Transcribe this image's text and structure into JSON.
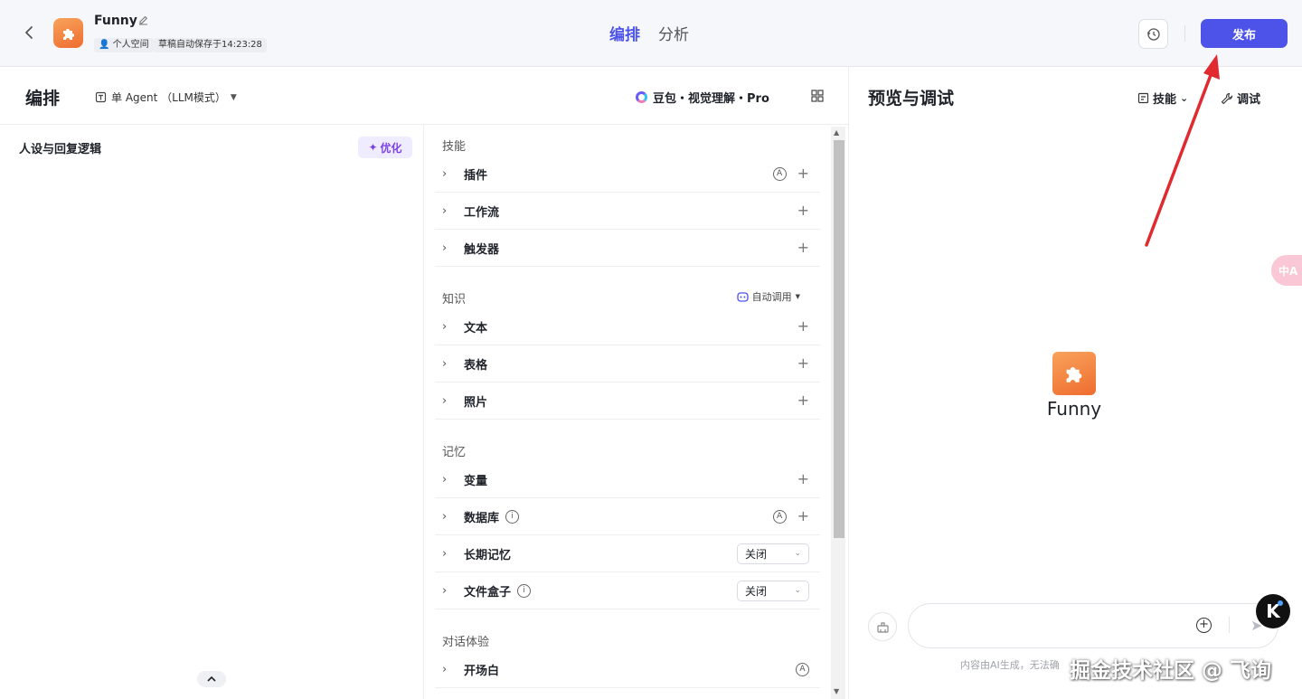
{
  "header": {
    "back_icon": "chevron-left-icon",
    "app_name": "Funny",
    "space_tag": "个人空间",
    "autosave_tag": "草稿自动保存于14:23:28",
    "tabs": [
      {
        "label": "编排",
        "active": true
      },
      {
        "label": "分析",
        "active": false
      }
    ],
    "history_icon": "history-icon",
    "publish_label": "发布"
  },
  "editor": {
    "title": "编排",
    "agent_mode": "单 Agent （LLM模式）",
    "model": "豆包・视觉理解・Pro",
    "persona_title": "人设与回复逻辑",
    "optimize_label": "优化"
  },
  "skills": {
    "sections": [
      {
        "title": "技能",
        "items": [
          {
            "label": "插件",
            "auto": true,
            "plus": true
          },
          {
            "label": "工作流",
            "plus": true
          },
          {
            "label": "触发器",
            "plus": true
          }
        ]
      },
      {
        "title": "知识",
        "extra": "自动调用",
        "items": [
          {
            "label": "文本",
            "plus": true
          },
          {
            "label": "表格",
            "plus": true
          },
          {
            "label": "照片",
            "plus": true
          }
        ]
      },
      {
        "title": "记忆",
        "items": [
          {
            "label": "变量",
            "plus": true
          },
          {
            "label": "数据库",
            "info": true,
            "auto": true,
            "plus": true
          },
          {
            "label": "长期记忆",
            "select": "关闭"
          },
          {
            "label": "文件盒子",
            "info": true,
            "select": "关闭"
          }
        ]
      },
      {
        "title": "对话体验",
        "items": [
          {
            "label": "开场白",
            "auto": true
          }
        ]
      }
    ]
  },
  "preview": {
    "title": "预览与调试",
    "skill_label": "技能",
    "debug_label": "调试",
    "bot_name": "Funny",
    "translate_fab": "中A",
    "input_placeholder": "",
    "disclaimer": "内容由AI生成，无法确",
    "watermark": "掘金技术社区 @ 飞询",
    "k_badge": "K"
  },
  "colors": {
    "accent": "#4d53e8",
    "optimize": "#7b43e6",
    "annotation_arrow": "#e02a2f",
    "app_icon": "#f08a45"
  }
}
